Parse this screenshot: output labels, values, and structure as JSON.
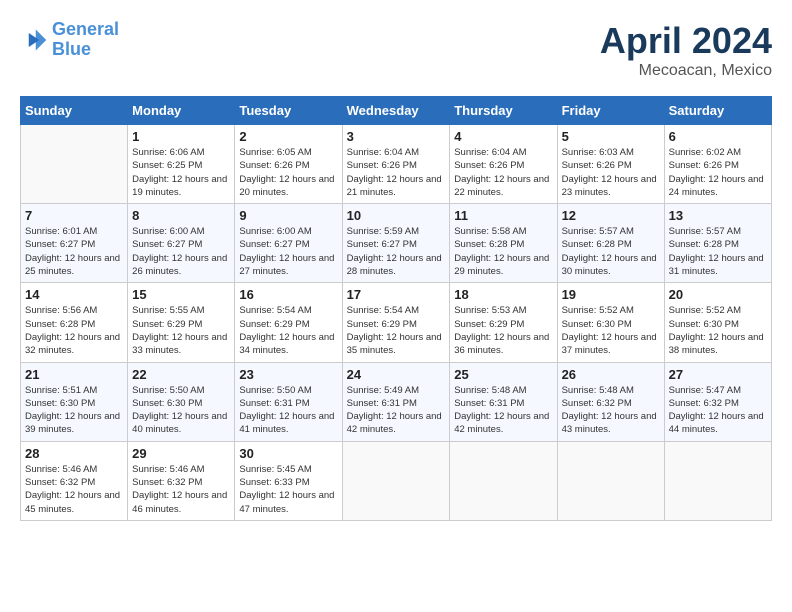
{
  "header": {
    "logo_line1": "General",
    "logo_line2": "Blue",
    "title": "April 2024",
    "subtitle": "Mecoacan, Mexico"
  },
  "columns": [
    "Sunday",
    "Monday",
    "Tuesday",
    "Wednesday",
    "Thursday",
    "Friday",
    "Saturday"
  ],
  "weeks": [
    [
      {
        "day": "",
        "info": ""
      },
      {
        "day": "1",
        "info": "Sunrise: 6:06 AM\nSunset: 6:25 PM\nDaylight: 12 hours\nand 19 minutes."
      },
      {
        "day": "2",
        "info": "Sunrise: 6:05 AM\nSunset: 6:26 PM\nDaylight: 12 hours\nand 20 minutes."
      },
      {
        "day": "3",
        "info": "Sunrise: 6:04 AM\nSunset: 6:26 PM\nDaylight: 12 hours\nand 21 minutes."
      },
      {
        "day": "4",
        "info": "Sunrise: 6:04 AM\nSunset: 6:26 PM\nDaylight: 12 hours\nand 22 minutes."
      },
      {
        "day": "5",
        "info": "Sunrise: 6:03 AM\nSunset: 6:26 PM\nDaylight: 12 hours\nand 23 minutes."
      },
      {
        "day": "6",
        "info": "Sunrise: 6:02 AM\nSunset: 6:26 PM\nDaylight: 12 hours\nand 24 minutes."
      }
    ],
    [
      {
        "day": "7",
        "info": "Sunrise: 6:01 AM\nSunset: 6:27 PM\nDaylight: 12 hours\nand 25 minutes."
      },
      {
        "day": "8",
        "info": "Sunrise: 6:00 AM\nSunset: 6:27 PM\nDaylight: 12 hours\nand 26 minutes."
      },
      {
        "day": "9",
        "info": "Sunrise: 6:00 AM\nSunset: 6:27 PM\nDaylight: 12 hours\nand 27 minutes."
      },
      {
        "day": "10",
        "info": "Sunrise: 5:59 AM\nSunset: 6:27 PM\nDaylight: 12 hours\nand 28 minutes."
      },
      {
        "day": "11",
        "info": "Sunrise: 5:58 AM\nSunset: 6:28 PM\nDaylight: 12 hours\nand 29 minutes."
      },
      {
        "day": "12",
        "info": "Sunrise: 5:57 AM\nSunset: 6:28 PM\nDaylight: 12 hours\nand 30 minutes."
      },
      {
        "day": "13",
        "info": "Sunrise: 5:57 AM\nSunset: 6:28 PM\nDaylight: 12 hours\nand 31 minutes."
      }
    ],
    [
      {
        "day": "14",
        "info": "Sunrise: 5:56 AM\nSunset: 6:28 PM\nDaylight: 12 hours\nand 32 minutes."
      },
      {
        "day": "15",
        "info": "Sunrise: 5:55 AM\nSunset: 6:29 PM\nDaylight: 12 hours\nand 33 minutes."
      },
      {
        "day": "16",
        "info": "Sunrise: 5:54 AM\nSunset: 6:29 PM\nDaylight: 12 hours\nand 34 minutes."
      },
      {
        "day": "17",
        "info": "Sunrise: 5:54 AM\nSunset: 6:29 PM\nDaylight: 12 hours\nand 35 minutes."
      },
      {
        "day": "18",
        "info": "Sunrise: 5:53 AM\nSunset: 6:29 PM\nDaylight: 12 hours\nand 36 minutes."
      },
      {
        "day": "19",
        "info": "Sunrise: 5:52 AM\nSunset: 6:30 PM\nDaylight: 12 hours\nand 37 minutes."
      },
      {
        "day": "20",
        "info": "Sunrise: 5:52 AM\nSunset: 6:30 PM\nDaylight: 12 hours\nand 38 minutes."
      }
    ],
    [
      {
        "day": "21",
        "info": "Sunrise: 5:51 AM\nSunset: 6:30 PM\nDaylight: 12 hours\nand 39 minutes."
      },
      {
        "day": "22",
        "info": "Sunrise: 5:50 AM\nSunset: 6:30 PM\nDaylight: 12 hours\nand 40 minutes."
      },
      {
        "day": "23",
        "info": "Sunrise: 5:50 AM\nSunset: 6:31 PM\nDaylight: 12 hours\nand 41 minutes."
      },
      {
        "day": "24",
        "info": "Sunrise: 5:49 AM\nSunset: 6:31 PM\nDaylight: 12 hours\nand 42 minutes."
      },
      {
        "day": "25",
        "info": "Sunrise: 5:48 AM\nSunset: 6:31 PM\nDaylight: 12 hours\nand 42 minutes."
      },
      {
        "day": "26",
        "info": "Sunrise: 5:48 AM\nSunset: 6:32 PM\nDaylight: 12 hours\nand 43 minutes."
      },
      {
        "day": "27",
        "info": "Sunrise: 5:47 AM\nSunset: 6:32 PM\nDaylight: 12 hours\nand 44 minutes."
      }
    ],
    [
      {
        "day": "28",
        "info": "Sunrise: 5:46 AM\nSunset: 6:32 PM\nDaylight: 12 hours\nand 45 minutes."
      },
      {
        "day": "29",
        "info": "Sunrise: 5:46 AM\nSunset: 6:32 PM\nDaylight: 12 hours\nand 46 minutes."
      },
      {
        "day": "30",
        "info": "Sunrise: 5:45 AM\nSunset: 6:33 PM\nDaylight: 12 hours\nand 47 minutes."
      },
      {
        "day": "",
        "info": ""
      },
      {
        "day": "",
        "info": ""
      },
      {
        "day": "",
        "info": ""
      },
      {
        "day": "",
        "info": ""
      }
    ]
  ]
}
